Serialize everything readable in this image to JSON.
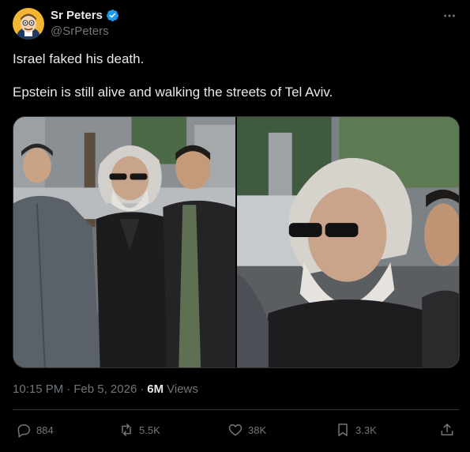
{
  "author": {
    "display_name": "Sr Peters",
    "handle": "@SrPeters",
    "verified": true,
    "avatar_icon": "cartoon-avatar"
  },
  "tweet": {
    "line1": "Israel faked his death.",
    "line2": "Epstein is still alive and walking the streets of Tel Aviv."
  },
  "meta": {
    "time": "10:15 PM",
    "separator1": "·",
    "date": "Feb 5, 2026",
    "separator2": "·",
    "views_count": "6M",
    "views_label": "Views"
  },
  "actions": {
    "replies": "884",
    "reposts": "5.5K",
    "likes": "38K",
    "bookmarks": "3.3K"
  },
  "colors": {
    "background": "#000000",
    "text_primary": "#e7e9ea",
    "text_secondary": "#71767b",
    "verified_blue": "#1d9bf0",
    "divider": "#2f3336"
  }
}
